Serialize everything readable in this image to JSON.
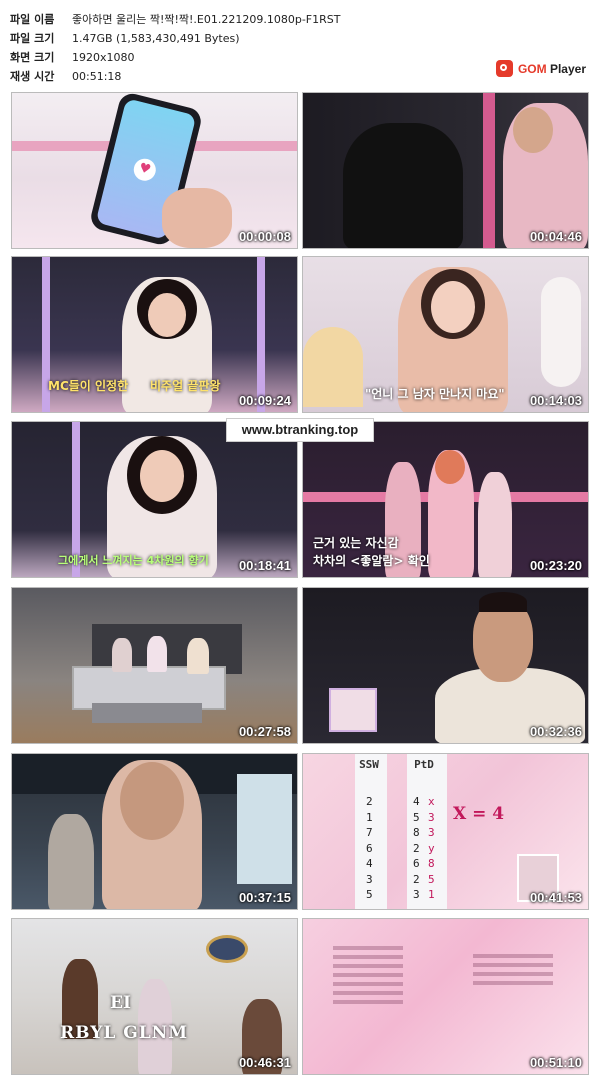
{
  "file_info": {
    "name_label": "파일 이름",
    "name_value": "좋아하면 울리는 짝!짝!짝!.E01.221209.1080p-F1RST",
    "size_label": "파일 크기",
    "size_value": "1.47GB (1,583,430,491 Bytes)",
    "resolution_label": "화면 크기",
    "resolution_value": "1920x1080",
    "duration_label": "재생 시간",
    "duration_value": "00:51:18"
  },
  "logo": {
    "brand": "GOM",
    "product": "Player"
  },
  "watermark": "www.btranking.top",
  "thumbnails": [
    {
      "timestamp": "00:00:08",
      "caption": ""
    },
    {
      "timestamp": "00:04:46",
      "caption": ""
    },
    {
      "timestamp": "00:09:24",
      "caption_small": "",
      "caption_line1": "MC들이 인정한",
      "caption_line2": "비주얼 끝판왕"
    },
    {
      "timestamp": "00:14:03",
      "caption": "\"언니 그 남자 만나지 마요\""
    },
    {
      "timestamp": "00:18:41",
      "caption": "그에게서 느껴지는 4차원의 향기"
    },
    {
      "timestamp": "00:23:20",
      "caption_line1": "근거 있는 자신감",
      "caption_line2": "차차의 <좋알람> 확인"
    },
    {
      "timestamp": "00:27:58",
      "caption": ""
    },
    {
      "timestamp": "00:32:36",
      "caption": ""
    },
    {
      "timestamp": "00:37:15",
      "caption": ""
    },
    {
      "timestamp": "00:41:53",
      "caption": "X = 4",
      "columns": [
        {
          "header": "SSW",
          "values": [
            "2",
            "1",
            "7",
            "6",
            "4",
            "3",
            "5"
          ]
        },
        {
          "header": "PtD",
          "values": [
            "4",
            "5",
            "8",
            "2",
            "6",
            "2",
            "3"
          ]
        },
        {
          "header": "",
          "values": [
            "x",
            "3",
            "3",
            "y",
            "8",
            "5",
            "1"
          ]
        }
      ]
    },
    {
      "timestamp": "00:46:31",
      "caption_line1": "EI",
      "caption_line2": "RBYL GLNM"
    },
    {
      "timestamp": "00:51:10",
      "caption": ""
    }
  ]
}
